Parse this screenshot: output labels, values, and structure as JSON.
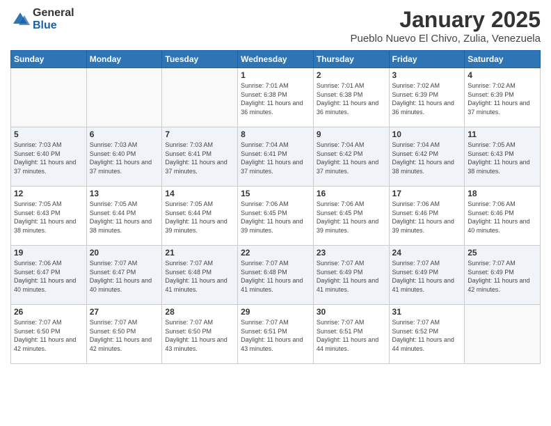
{
  "logo": {
    "general": "General",
    "blue": "Blue"
  },
  "header": {
    "title": "January 2025",
    "subtitle": "Pueblo Nuevo El Chivo, Zulia, Venezuela"
  },
  "weekdays": [
    "Sunday",
    "Monday",
    "Tuesday",
    "Wednesday",
    "Thursday",
    "Friday",
    "Saturday"
  ],
  "weeks": [
    [
      {
        "day": "",
        "sunrise": "",
        "sunset": "",
        "daylight": ""
      },
      {
        "day": "",
        "sunrise": "",
        "sunset": "",
        "daylight": ""
      },
      {
        "day": "",
        "sunrise": "",
        "sunset": "",
        "daylight": ""
      },
      {
        "day": "1",
        "sunrise": "Sunrise: 7:01 AM",
        "sunset": "Sunset: 6:38 PM",
        "daylight": "Daylight: 11 hours and 36 minutes."
      },
      {
        "day": "2",
        "sunrise": "Sunrise: 7:01 AM",
        "sunset": "Sunset: 6:38 PM",
        "daylight": "Daylight: 11 hours and 36 minutes."
      },
      {
        "day": "3",
        "sunrise": "Sunrise: 7:02 AM",
        "sunset": "Sunset: 6:39 PM",
        "daylight": "Daylight: 11 hours and 36 minutes."
      },
      {
        "day": "4",
        "sunrise": "Sunrise: 7:02 AM",
        "sunset": "Sunset: 6:39 PM",
        "daylight": "Daylight: 11 hours and 37 minutes."
      }
    ],
    [
      {
        "day": "5",
        "sunrise": "Sunrise: 7:03 AM",
        "sunset": "Sunset: 6:40 PM",
        "daylight": "Daylight: 11 hours and 37 minutes."
      },
      {
        "day": "6",
        "sunrise": "Sunrise: 7:03 AM",
        "sunset": "Sunset: 6:40 PM",
        "daylight": "Daylight: 11 hours and 37 minutes."
      },
      {
        "day": "7",
        "sunrise": "Sunrise: 7:03 AM",
        "sunset": "Sunset: 6:41 PM",
        "daylight": "Daylight: 11 hours and 37 minutes."
      },
      {
        "day": "8",
        "sunrise": "Sunrise: 7:04 AM",
        "sunset": "Sunset: 6:41 PM",
        "daylight": "Daylight: 11 hours and 37 minutes."
      },
      {
        "day": "9",
        "sunrise": "Sunrise: 7:04 AM",
        "sunset": "Sunset: 6:42 PM",
        "daylight": "Daylight: 11 hours and 37 minutes."
      },
      {
        "day": "10",
        "sunrise": "Sunrise: 7:04 AM",
        "sunset": "Sunset: 6:42 PM",
        "daylight": "Daylight: 11 hours and 38 minutes."
      },
      {
        "day": "11",
        "sunrise": "Sunrise: 7:05 AM",
        "sunset": "Sunset: 6:43 PM",
        "daylight": "Daylight: 11 hours and 38 minutes."
      }
    ],
    [
      {
        "day": "12",
        "sunrise": "Sunrise: 7:05 AM",
        "sunset": "Sunset: 6:43 PM",
        "daylight": "Daylight: 11 hours and 38 minutes."
      },
      {
        "day": "13",
        "sunrise": "Sunrise: 7:05 AM",
        "sunset": "Sunset: 6:44 PM",
        "daylight": "Daylight: 11 hours and 38 minutes."
      },
      {
        "day": "14",
        "sunrise": "Sunrise: 7:05 AM",
        "sunset": "Sunset: 6:44 PM",
        "daylight": "Daylight: 11 hours and 39 minutes."
      },
      {
        "day": "15",
        "sunrise": "Sunrise: 7:06 AM",
        "sunset": "Sunset: 6:45 PM",
        "daylight": "Daylight: 11 hours and 39 minutes."
      },
      {
        "day": "16",
        "sunrise": "Sunrise: 7:06 AM",
        "sunset": "Sunset: 6:45 PM",
        "daylight": "Daylight: 11 hours and 39 minutes."
      },
      {
        "day": "17",
        "sunrise": "Sunrise: 7:06 AM",
        "sunset": "Sunset: 6:46 PM",
        "daylight": "Daylight: 11 hours and 39 minutes."
      },
      {
        "day": "18",
        "sunrise": "Sunrise: 7:06 AM",
        "sunset": "Sunset: 6:46 PM",
        "daylight": "Daylight: 11 hours and 40 minutes."
      }
    ],
    [
      {
        "day": "19",
        "sunrise": "Sunrise: 7:06 AM",
        "sunset": "Sunset: 6:47 PM",
        "daylight": "Daylight: 11 hours and 40 minutes."
      },
      {
        "day": "20",
        "sunrise": "Sunrise: 7:07 AM",
        "sunset": "Sunset: 6:47 PM",
        "daylight": "Daylight: 11 hours and 40 minutes."
      },
      {
        "day": "21",
        "sunrise": "Sunrise: 7:07 AM",
        "sunset": "Sunset: 6:48 PM",
        "daylight": "Daylight: 11 hours and 41 minutes."
      },
      {
        "day": "22",
        "sunrise": "Sunrise: 7:07 AM",
        "sunset": "Sunset: 6:48 PM",
        "daylight": "Daylight: 11 hours and 41 minutes."
      },
      {
        "day": "23",
        "sunrise": "Sunrise: 7:07 AM",
        "sunset": "Sunset: 6:49 PM",
        "daylight": "Daylight: 11 hours and 41 minutes."
      },
      {
        "day": "24",
        "sunrise": "Sunrise: 7:07 AM",
        "sunset": "Sunset: 6:49 PM",
        "daylight": "Daylight: 11 hours and 41 minutes."
      },
      {
        "day": "25",
        "sunrise": "Sunrise: 7:07 AM",
        "sunset": "Sunset: 6:49 PM",
        "daylight": "Daylight: 11 hours and 42 minutes."
      }
    ],
    [
      {
        "day": "26",
        "sunrise": "Sunrise: 7:07 AM",
        "sunset": "Sunset: 6:50 PM",
        "daylight": "Daylight: 11 hours and 42 minutes."
      },
      {
        "day": "27",
        "sunrise": "Sunrise: 7:07 AM",
        "sunset": "Sunset: 6:50 PM",
        "daylight": "Daylight: 11 hours and 42 minutes."
      },
      {
        "day": "28",
        "sunrise": "Sunrise: 7:07 AM",
        "sunset": "Sunset: 6:50 PM",
        "daylight": "Daylight: 11 hours and 43 minutes."
      },
      {
        "day": "29",
        "sunrise": "Sunrise: 7:07 AM",
        "sunset": "Sunset: 6:51 PM",
        "daylight": "Daylight: 11 hours and 43 minutes."
      },
      {
        "day": "30",
        "sunrise": "Sunrise: 7:07 AM",
        "sunset": "Sunset: 6:51 PM",
        "daylight": "Daylight: 11 hours and 44 minutes."
      },
      {
        "day": "31",
        "sunrise": "Sunrise: 7:07 AM",
        "sunset": "Sunset: 6:52 PM",
        "daylight": "Daylight: 11 hours and 44 minutes."
      },
      {
        "day": "",
        "sunrise": "",
        "sunset": "",
        "daylight": ""
      }
    ]
  ]
}
